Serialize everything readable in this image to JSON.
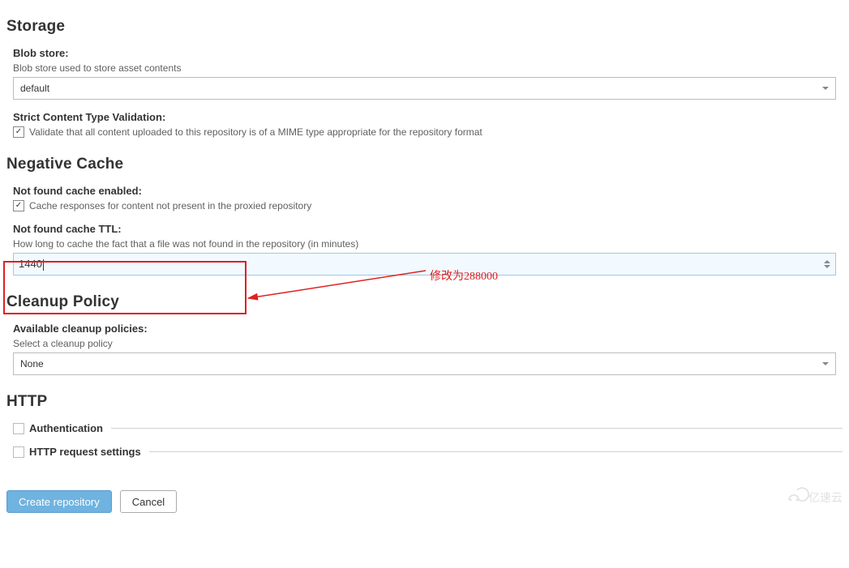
{
  "storage": {
    "title": "Storage",
    "blobStore": {
      "label": "Blob store:",
      "help": "Blob store used to store asset contents",
      "value": "default"
    },
    "strictValidation": {
      "label": "Strict Content Type Validation:",
      "checked": true,
      "text": "Validate that all content uploaded to this repository is of a MIME type appropriate for the repository format"
    }
  },
  "negativeCache": {
    "title": "Negative Cache",
    "enabled": {
      "label": "Not found cache enabled:",
      "checked": true,
      "text": "Cache responses for content not present in the proxied repository"
    },
    "ttl": {
      "label": "Not found cache TTL:",
      "help": "How long to cache the fact that a file was not found in the repository (in minutes)",
      "value": "1440"
    }
  },
  "cleanup": {
    "title": "Cleanup Policy",
    "available": {
      "label": "Available cleanup policies:",
      "help": "Select a cleanup policy",
      "value": "None"
    }
  },
  "http": {
    "title": "HTTP",
    "auth": {
      "label": "Authentication",
      "checked": false
    },
    "reqSettings": {
      "label": "HTTP request settings",
      "checked": false
    }
  },
  "buttons": {
    "create": "Create repository",
    "cancel": "Cancel"
  },
  "annotation": {
    "text": "修改为288000"
  },
  "watermark": "亿速云"
}
